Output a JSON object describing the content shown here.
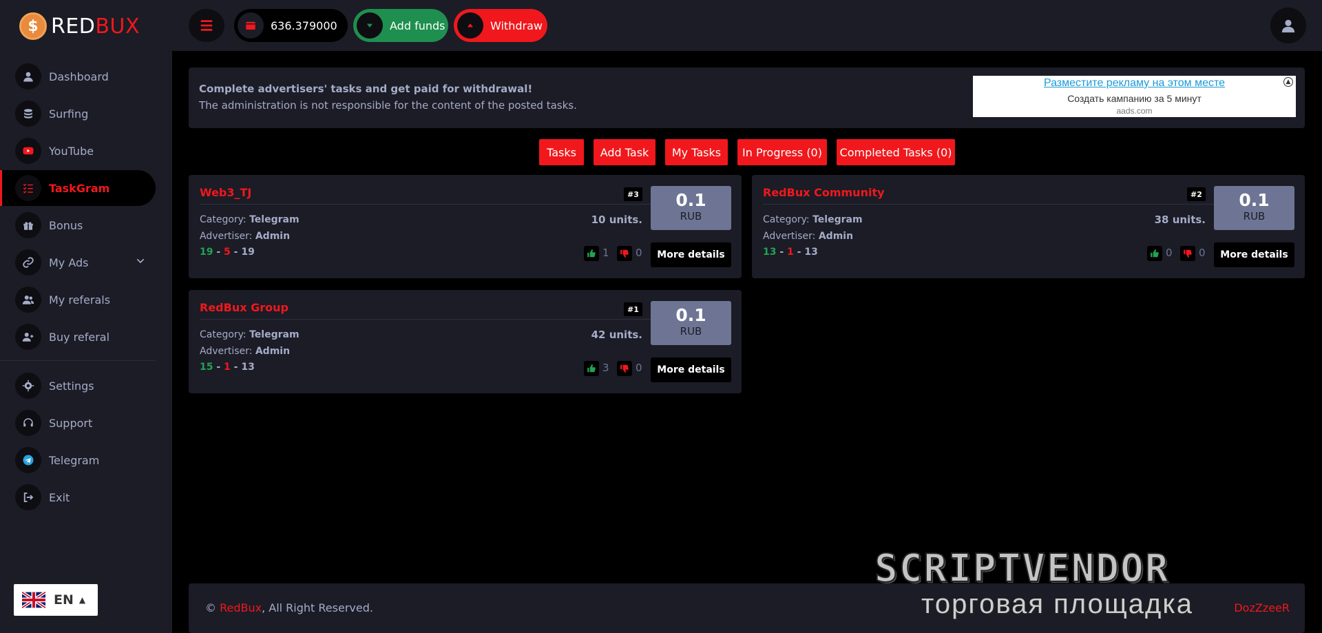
{
  "brand": {
    "part1": "RED",
    "part2": "BUX",
    "coin_symbol": "$"
  },
  "colors": {
    "accent": "#f0181c",
    "green": "#1f8f4f",
    "panel": "#1b1c26",
    "muted": "#a5acc7"
  },
  "sidebar": {
    "items": [
      {
        "label": "Dashboard",
        "icon": "user-icon"
      },
      {
        "label": "Surfing",
        "icon": "coins-icon"
      },
      {
        "label": "YouTube",
        "icon": "youtube-icon"
      },
      {
        "label": "TaskGram",
        "icon": "list-check-icon",
        "active": true
      },
      {
        "label": "Bonus",
        "icon": "gift-icon"
      },
      {
        "label": "My Ads",
        "icon": "link-icon"
      },
      {
        "label": "My referals",
        "icon": "users-icon"
      },
      {
        "label": "Buy referal",
        "icon": "user-plus-icon"
      },
      {
        "label": "Settings",
        "icon": "gear-icon"
      },
      {
        "label": "Support",
        "icon": "headset-icon"
      },
      {
        "label": "Telegram",
        "icon": "telegram-icon"
      },
      {
        "label": "Exit",
        "icon": "sign-out-icon"
      }
    ]
  },
  "lang": {
    "code": "EN"
  },
  "topbar": {
    "balance": "636.379000",
    "add_funds": "Add funds",
    "withdraw": "Withdraw"
  },
  "info": {
    "line1": "Complete advertisers' tasks and get paid for withdrawal!",
    "line2": "The administration is not responsible for the content of the posted tasks."
  },
  "ad": {
    "title": "Разместите рекламу на этом месте",
    "subtitle": "Создать кампанию за 5 минут",
    "domain": "aads.com"
  },
  "tabs": [
    "Tasks",
    "Add Task",
    "My Tasks",
    "In Progress (0)",
    "Completed Tasks (0)"
  ],
  "cards": [
    {
      "title": "Web3_TJ",
      "num": "#3",
      "category_label": "Category:",
      "category": "Telegram",
      "advertiser_label": "Advertiser:",
      "advertiser": "Admin",
      "s1": "19",
      "s2": "5",
      "s3": "19",
      "sep": "-",
      "units": "10 units.",
      "price": "0.1",
      "currency": "RUB",
      "likes": "1",
      "dislikes": "0",
      "more": "More details"
    },
    {
      "title": "RedBux Community",
      "num": "#2",
      "category_label": "Category:",
      "category": "Telegram",
      "advertiser_label": "Advertiser:",
      "advertiser": "Admin",
      "s1": "13",
      "s2": "1",
      "s3": "13",
      "sep": "-",
      "units": "38 units.",
      "price": "0.1",
      "currency": "RUB",
      "likes": "0",
      "dislikes": "0",
      "more": "More details"
    },
    {
      "title": "RedBux Group",
      "num": "#1",
      "category_label": "Category:",
      "category": "Telegram",
      "advertiser_label": "Advertiser:",
      "advertiser": "Admin",
      "s1": "15",
      "s2": "1",
      "s3": "13",
      "sep": "-",
      "units": "42 units.",
      "price": "0.1",
      "currency": "RUB",
      "likes": "3",
      "dislikes": "0",
      "more": "More details"
    }
  ],
  "footer": {
    "copy_symbol": "©",
    "brand": "RedBux",
    "rights": ", All Right Reserved.",
    "author": "DozZzeeR"
  },
  "watermark": {
    "line1": "SCRIPTVENDOR",
    "line2": "торговая площадка"
  }
}
